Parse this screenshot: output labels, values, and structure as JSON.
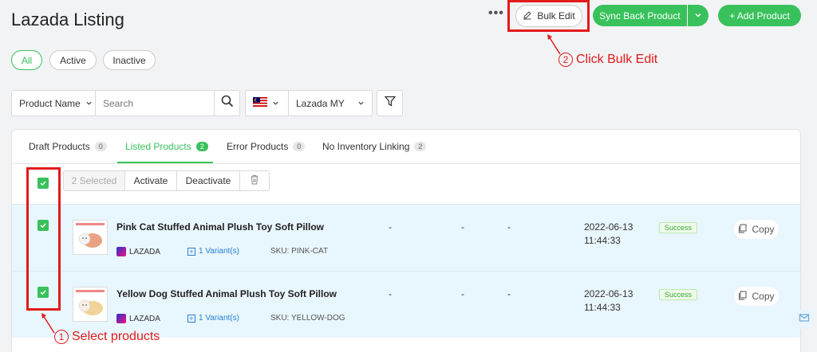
{
  "header": {
    "title": "Lazada Listing",
    "more_label": "•••",
    "bulk_edit_label": "Bulk Edit",
    "sync_label": "Sync Back Product",
    "add_label": "+ Add Product"
  },
  "annotations": {
    "step2_num": "2",
    "step2_text": "Click Bulk Edit",
    "step1_num": "1",
    "step1_text": "Select products"
  },
  "filters": {
    "status_pills": [
      "All",
      "Active",
      "Inactive"
    ],
    "active_pill": "All",
    "search_field_label": "Product Name",
    "search_placeholder": "Search",
    "store_name": "Lazada MY"
  },
  "tabs": [
    {
      "label": "Draft Products",
      "count": "0"
    },
    {
      "label": "Listed Products",
      "count": "2"
    },
    {
      "label": "Error Products",
      "count": "0"
    },
    {
      "label": "No Inventory Linking",
      "count": "2"
    }
  ],
  "active_tab": "Listed Products",
  "bulk_actions": {
    "selected_label": "2 Selected",
    "activate_label": "Activate",
    "deactivate_label": "Deactivate"
  },
  "products": [
    {
      "name": "Pink Cat Stuffed Animal Plush Toy Soft Pillow",
      "platform": "LAZADA",
      "variants": "1 Variant(s)",
      "sku": "SKU: PINK-CAT",
      "col1": "-",
      "col2": "-",
      "col3": "-",
      "date": "2022-06-13",
      "time": "11:44:33",
      "status": "Success",
      "copy_label": "Copy"
    },
    {
      "name": "Yellow Dog Stuffed Animal Plush Toy Soft Pillow",
      "platform": "LAZADA",
      "variants": "1 Variant(s)",
      "sku": "SKU: YELLOW-DOG",
      "col1": "-",
      "col2": "-",
      "col3": "-",
      "date": "2022-06-13",
      "time": "11:44:33",
      "status": "Success",
      "copy_label": "Copy"
    }
  ],
  "colors": {
    "brand_green": "#39c15c",
    "annotation_red": "#e21b1b",
    "row_selected": "#e8f6fd",
    "link_blue": "#2a7fd4"
  }
}
